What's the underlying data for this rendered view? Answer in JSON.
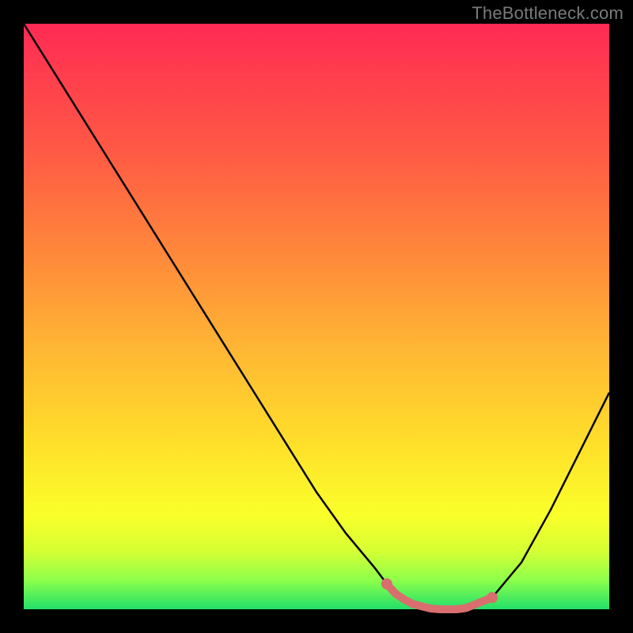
{
  "watermark": "TheBottleneck.com",
  "chart_data": {
    "type": "line",
    "title": "",
    "xlabel": "",
    "ylabel": "",
    "x": [
      0,
      5,
      10,
      15,
      20,
      25,
      30,
      35,
      40,
      45,
      50,
      55,
      60,
      63,
      66,
      70,
      75,
      80,
      85,
      90,
      100
    ],
    "values": [
      100,
      92,
      84,
      76,
      68,
      60,
      52,
      44,
      36,
      28,
      20,
      13,
      7,
      3,
      1,
      0,
      0,
      2,
      8,
      17,
      37
    ],
    "ylim": [
      0,
      100
    ],
    "xlim": [
      0,
      100
    ],
    "annotations": [
      {
        "type": "highlight-band",
        "x_start": 62,
        "x_end": 80,
        "color": "#e07a7a"
      }
    ],
    "background_gradient": [
      {
        "stop": 0,
        "color": "#ff2a55"
      },
      {
        "stop": 0.5,
        "color": "#ffb534"
      },
      {
        "stop": 0.85,
        "color": "#faff2a"
      },
      {
        "stop": 1.0,
        "color": "#22e06a"
      }
    ]
  }
}
